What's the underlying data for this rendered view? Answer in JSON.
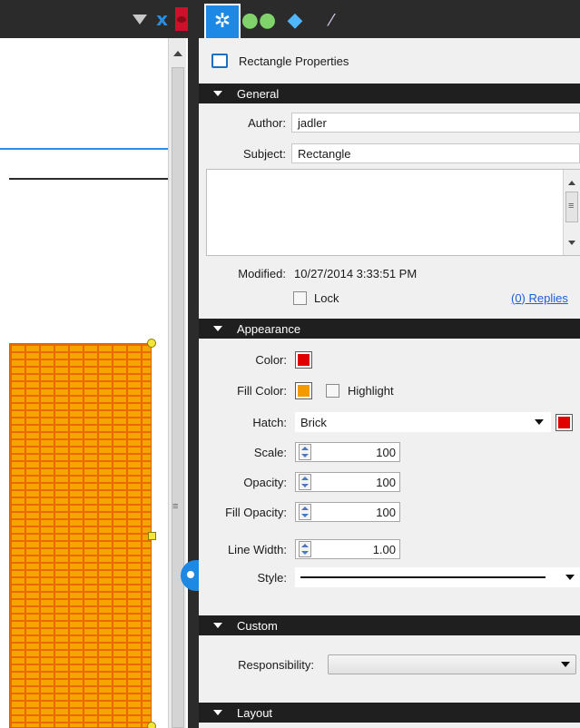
{
  "panel": {
    "title": "Rectangle Properties",
    "tabs": [
      {
        "icon": "gear-icon",
        "active": true
      },
      {
        "icon": "binoculars-icon"
      },
      {
        "icon": "cube-icon"
      },
      {
        "icon": "ruler-icon"
      }
    ]
  },
  "sections": {
    "general": "General",
    "appearance": "Appearance",
    "custom": "Custom",
    "layout": "Layout"
  },
  "general": {
    "author_label": "Author:",
    "author_value": "jadler",
    "subject_label": "Subject:",
    "subject_value": "Rectangle",
    "modified_label": "Modified:",
    "modified_value": "10/27/2014 3:33:51 PM",
    "lock_label": "Lock",
    "replies_link": "(0) Replies"
  },
  "appearance": {
    "color_label": "Color:",
    "color_value": "#e00000",
    "fill_color_label": "Fill Color:",
    "fill_color_value": "#f39a00",
    "highlight_label": "Highlight",
    "hatch_label": "Hatch:",
    "hatch_value": "Brick",
    "hatch_color": "#e00000",
    "scale_label": "Scale:",
    "scale_value": "100",
    "opacity_label": "Opacity:",
    "opacity_value": "100",
    "fill_opacity_label": "Fill Opacity:",
    "fill_opacity_value": "100",
    "line_width_label": "Line Width:",
    "line_width_value": "1.00",
    "style_label": "Style:"
  },
  "custom": {
    "responsibility_label": "Responsibility:",
    "responsibility_value": ""
  }
}
